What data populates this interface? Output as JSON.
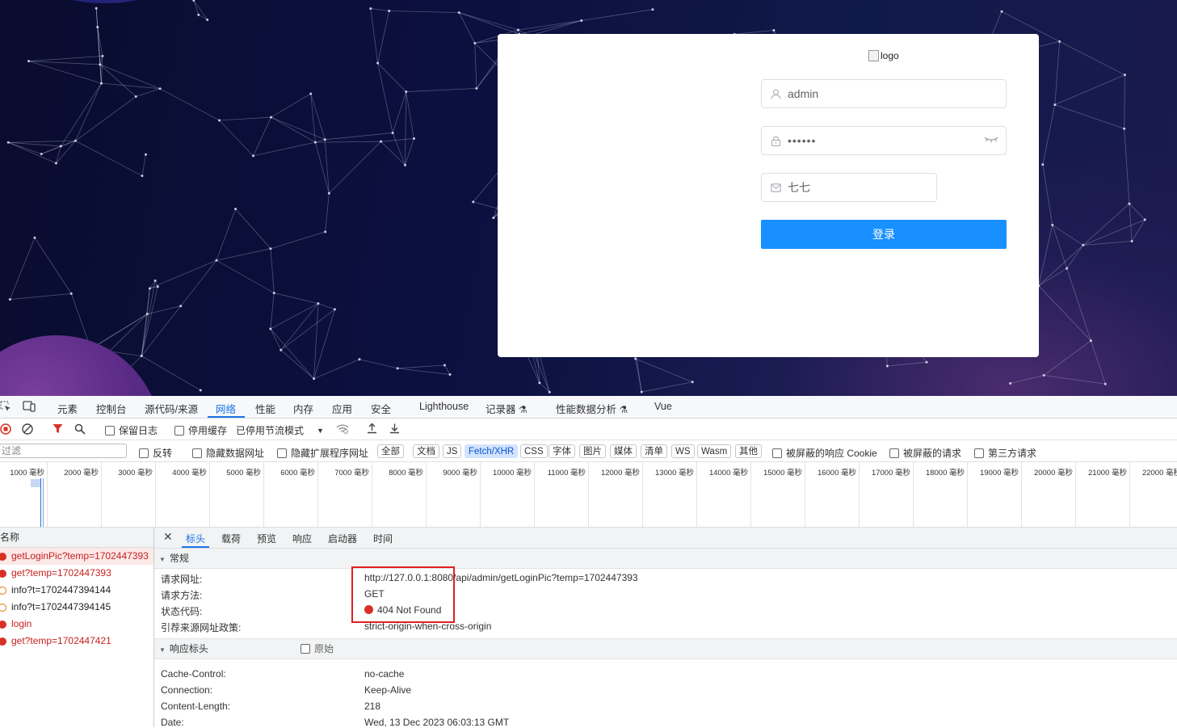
{
  "login": {
    "logo_alt": "logo",
    "username": "admin",
    "password": "••••••",
    "captcha": "七七",
    "submit_label": "登录"
  },
  "devtools": {
    "panel_tabs": [
      "元素",
      "控制台",
      "源代码/来源",
      "网络",
      "性能",
      "内存",
      "应用",
      "安全",
      "Lighthouse",
      "记录器",
      "性能数据分析",
      "Vue"
    ],
    "toolbar": {
      "preserve_log": "保留日志",
      "disable_cache": "停用缓存",
      "throttle": "已停用节流模式"
    },
    "filter": {
      "placeholder": "过滤",
      "invert": "反转",
      "hide_data_urls": "隐藏数据网址",
      "hide_ext_urls": "隐藏扩展程序网址",
      "types": [
        "全部",
        "文档",
        "JS",
        "Fetch/XHR",
        "CSS",
        "字体",
        "图片",
        "媒体",
        "清单",
        "WS",
        "Wasm",
        "其他"
      ],
      "active_type": "Fetch/XHR",
      "blocked_cookies": "被屏蔽的响应 Cookie",
      "blocked_requests": "被屏蔽的请求",
      "third_party": "第三方请求"
    },
    "timeline_ticks": [
      "1000 毫秒",
      "2000 毫秒",
      "3000 毫秒",
      "4000 毫秒",
      "5000 毫秒",
      "6000 毫秒",
      "7000 毫秒",
      "8000 毫秒",
      "9000 毫秒",
      "10000 毫秒",
      "11000 毫秒",
      "12000 毫秒",
      "13000 毫秒",
      "14000 毫秒",
      "15000 毫秒",
      "16000 毫秒",
      "17000 毫秒",
      "18000 毫秒",
      "19000 毫秒",
      "20000 毫秒",
      "21000 毫秒",
      "22000 毫秒"
    ],
    "requests_header": "名称",
    "requests": [
      {
        "name": "getLoginPic?temp=1702447393",
        "state": "error",
        "selected": true
      },
      {
        "name": "get?temp=1702447393",
        "state": "error",
        "selected": false
      },
      {
        "name": "info?t=1702447394144",
        "state": "pending",
        "selected": false
      },
      {
        "name": "info?t=1702447394145",
        "state": "pending",
        "selected": false
      },
      {
        "name": "login",
        "state": "error",
        "selected": false
      },
      {
        "name": "get?temp=1702447421",
        "state": "error",
        "selected": false
      }
    ],
    "detail_tabs": [
      "标头",
      "载荷",
      "预览",
      "响应",
      "启动器",
      "时间"
    ],
    "general_title": "常规",
    "general": [
      {
        "key": "请求网址:",
        "value": "http://127.0.0.1:8080/api/admin/getLoginPic?temp=1702447393"
      },
      {
        "key": "请求方法:",
        "value": "GET"
      },
      {
        "key": "状态代码:",
        "value": "404 Not Found"
      },
      {
        "key": "引荐来源网址政策:",
        "value": "strict-origin-when-cross-origin"
      }
    ],
    "response_headers_title": "响应标头",
    "raw_label": "原始",
    "response_headers": [
      {
        "key": "Cache-Control:",
        "value": "no-cache"
      },
      {
        "key": "Connection:",
        "value": "Keep-Alive"
      },
      {
        "key": "Content-Length:",
        "value": "218"
      },
      {
        "key": "Date:",
        "value": "Wed, 13 Dec 2023 06:03:13 GMT"
      }
    ],
    "colors": {
      "accent": "#1a73e8",
      "error": "#d93025",
      "login_button": "#1890ff",
      "highlight_box": "#e02020"
    }
  }
}
